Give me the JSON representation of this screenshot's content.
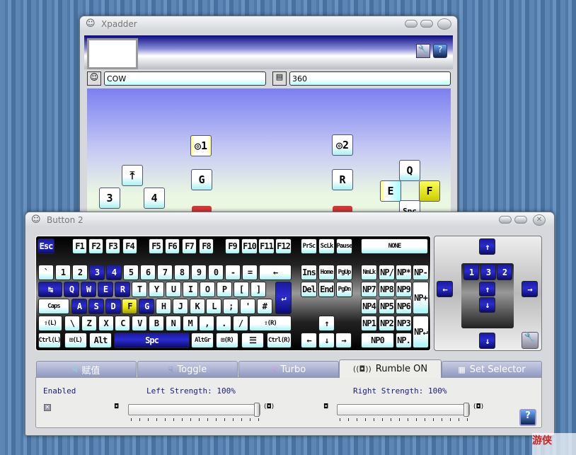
{
  "main_window": {
    "title": "Xpadder",
    "profile_name": "COW",
    "layout_name": "360",
    "pad_buttons": [
      {
        "label": "◎1",
        "state": "yellow"
      },
      {
        "label": "◎2",
        "state": "normal"
      },
      {
        "label": "G",
        "state": "normal"
      },
      {
        "label": "R",
        "state": "normal"
      },
      {
        "label": "⤒",
        "state": "normal"
      },
      {
        "label": "3",
        "state": "normal"
      },
      {
        "label": "4",
        "state": "normal"
      },
      {
        "label": "Q",
        "state": "normal"
      },
      {
        "label": "E",
        "state": "yellow"
      },
      {
        "label": "F",
        "state": "yellow-strong"
      },
      {
        "label": "Spc",
        "state": "yellow"
      }
    ]
  },
  "button_window": {
    "title": "Button 2",
    "keyboard": {
      "rows": [
        [
          {
            "k": "Esc",
            "s": "blue"
          },
          {
            "k": "F1"
          },
          {
            "k": "F2"
          },
          {
            "k": "F3"
          },
          {
            "k": "F4"
          },
          {
            "k": "F5"
          },
          {
            "k": "F6"
          },
          {
            "k": "F7"
          },
          {
            "k": "F8"
          },
          {
            "k": "F9"
          },
          {
            "k": "F10"
          },
          {
            "k": "F11"
          },
          {
            "k": "F12"
          }
        ],
        [
          {
            "k": "`"
          },
          {
            "k": "1"
          },
          {
            "k": "2"
          },
          {
            "k": "3",
            "s": "blue"
          },
          {
            "k": "4",
            "s": "blue"
          },
          {
            "k": "5"
          },
          {
            "k": "6"
          },
          {
            "k": "7"
          },
          {
            "k": "8"
          },
          {
            "k": "9"
          },
          {
            "k": "0"
          },
          {
            "k": "-"
          },
          {
            "k": "="
          },
          {
            "k": "←"
          }
        ],
        [
          {
            "k": "↹",
            "s": "blue"
          },
          {
            "k": "Q",
            "s": "blue"
          },
          {
            "k": "W",
            "s": "blue"
          },
          {
            "k": "E",
            "s": "blue"
          },
          {
            "k": "R",
            "s": "blue"
          },
          {
            "k": "T"
          },
          {
            "k": "Y"
          },
          {
            "k": "U"
          },
          {
            "k": "I"
          },
          {
            "k": "O"
          },
          {
            "k": "P"
          },
          {
            "k": "["
          },
          {
            "k": "]"
          },
          {
            "k": "↵",
            "s": "blue"
          }
        ],
        [
          {
            "k": "Caps"
          },
          {
            "k": "A",
            "s": "blue"
          },
          {
            "k": "S",
            "s": "blue"
          },
          {
            "k": "D",
            "s": "blue"
          },
          {
            "k": "F",
            "s": "yellow"
          },
          {
            "k": "G",
            "s": "blue"
          },
          {
            "k": "H"
          },
          {
            "k": "J"
          },
          {
            "k": "K"
          },
          {
            "k": "L"
          },
          {
            "k": ";"
          },
          {
            "k": "'"
          },
          {
            "k": "#"
          }
        ],
        [
          {
            "k": "⇧(L)"
          },
          {
            "k": "\\"
          },
          {
            "k": "Z"
          },
          {
            "k": "X"
          },
          {
            "k": "C"
          },
          {
            "k": "V"
          },
          {
            "k": "B"
          },
          {
            "k": "N"
          },
          {
            "k": "M"
          },
          {
            "k": ","
          },
          {
            "k": "."
          },
          {
            "k": "/"
          },
          {
            "k": "⇧(R)"
          }
        ],
        [
          {
            "k": "Ctrl(L)"
          },
          {
            "k": "⊞(L)"
          },
          {
            "k": "Alt"
          },
          {
            "k": "Spc",
            "s": "blue"
          },
          {
            "k": "AltGr"
          },
          {
            "k": "⊞(R)"
          },
          {
            "k": "☰"
          },
          {
            "k": "Ctrl(R)"
          }
        ]
      ],
      "nav": [
        "PrSc",
        "ScLk",
        "Pause",
        "Ins",
        "Home",
        "PgUp",
        "Del",
        "End",
        "PgDn",
        "↑",
        "←",
        "↓",
        "→"
      ],
      "none_label": "NONE",
      "numpad": [
        "NmLk",
        "NP/",
        "NP*",
        "NP-",
        "NP7",
        "NP8",
        "NP9",
        "NP+",
        "NP4",
        "NP5",
        "NP6",
        "NP1",
        "NP2",
        "NP3",
        "NP↵",
        "NP0",
        "NP."
      ]
    },
    "mouse": {
      "up": "↑",
      "down": "↓",
      "left": "←",
      "right": "→",
      "buttons": [
        "1",
        "3",
        "2"
      ],
      "wheel_up": "↑",
      "wheel_down": "↓"
    },
    "tabs": [
      {
        "label": "赋值",
        "icon": "hand-cyan"
      },
      {
        "label": "Toggle",
        "icon": "hand-blue"
      },
      {
        "label": "Turbo",
        "icon": "hand-pink"
      },
      {
        "label": "Rumble ON",
        "icon": "rumble",
        "active": true
      },
      {
        "label": "Set Selector",
        "icon": "grid"
      }
    ],
    "rumble": {
      "enabled_label": "Enabled",
      "enabled": true,
      "left_label": "Left Strength: 100%",
      "left_value": 100,
      "right_label": "Right Strength: 100%",
      "right_value": 100
    }
  }
}
